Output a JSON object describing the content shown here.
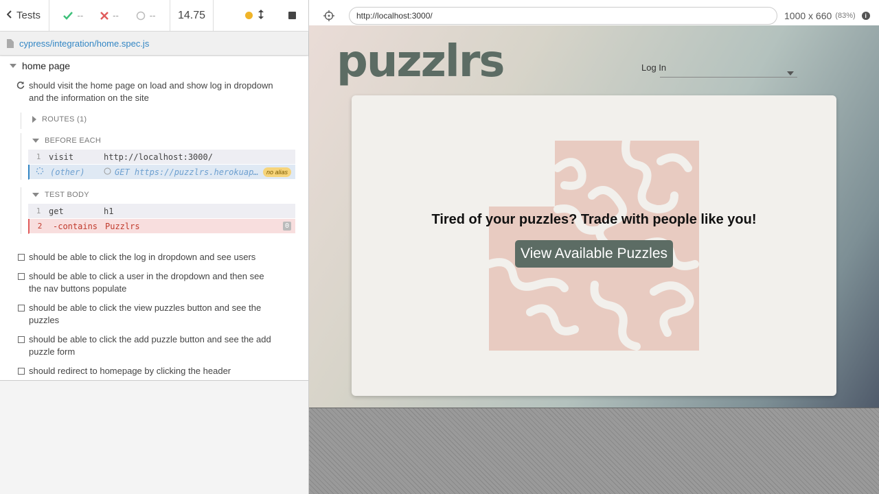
{
  "reporter": {
    "back_label": "Tests",
    "passed": "--",
    "failed": "--",
    "pending": "--",
    "duration": "14.75",
    "spec_path": "cypress/integration/home.spec.js"
  },
  "suite": {
    "title": "home page",
    "active_test": "should visit the home page on load and show log in dropdown and the information on the site",
    "routes_label": "ROUTES (1)",
    "before_each_label": "BEFORE EACH",
    "before_each_commands": [
      {
        "num": "1",
        "name": "visit",
        "message": "http://localhost:3000/"
      },
      {
        "num": "",
        "name": "(other)",
        "message": "GET https://puzzlrs.herokuapp.com/",
        "badge": "no alias"
      }
    ],
    "test_body_label": "TEST BODY",
    "test_body_commands": [
      {
        "num": "1",
        "name": "get",
        "message": "h1"
      },
      {
        "num": "2",
        "name": "-contains",
        "message": "Puzzlrs",
        "count": "0"
      }
    ],
    "tests": [
      "should be able to click the log in dropdown and see users",
      "should be able to click a user in the dropdown and then see the nav buttons populate",
      "should be able to click the view puzzles button and see the puzzles",
      "should be able to click the add puzzle button and see the add puzzle form",
      "should redirect to homepage by clicking the header"
    ]
  },
  "browser": {
    "url": "http://localhost:3000/",
    "viewport": "1000 x 660",
    "scale": "(83%)"
  },
  "app": {
    "logo": "puzzlrs",
    "login_label": "Log In",
    "tagline": "Tired of your puzzles? Trade with people like you!",
    "cta_label": "View Available Puzzles"
  },
  "colors": {
    "pass": "#3ec07a",
    "fail": "#e05c5c",
    "brand": "#5c6c64",
    "puzzle": "#e8cbc1",
    "link": "#3386c4"
  }
}
